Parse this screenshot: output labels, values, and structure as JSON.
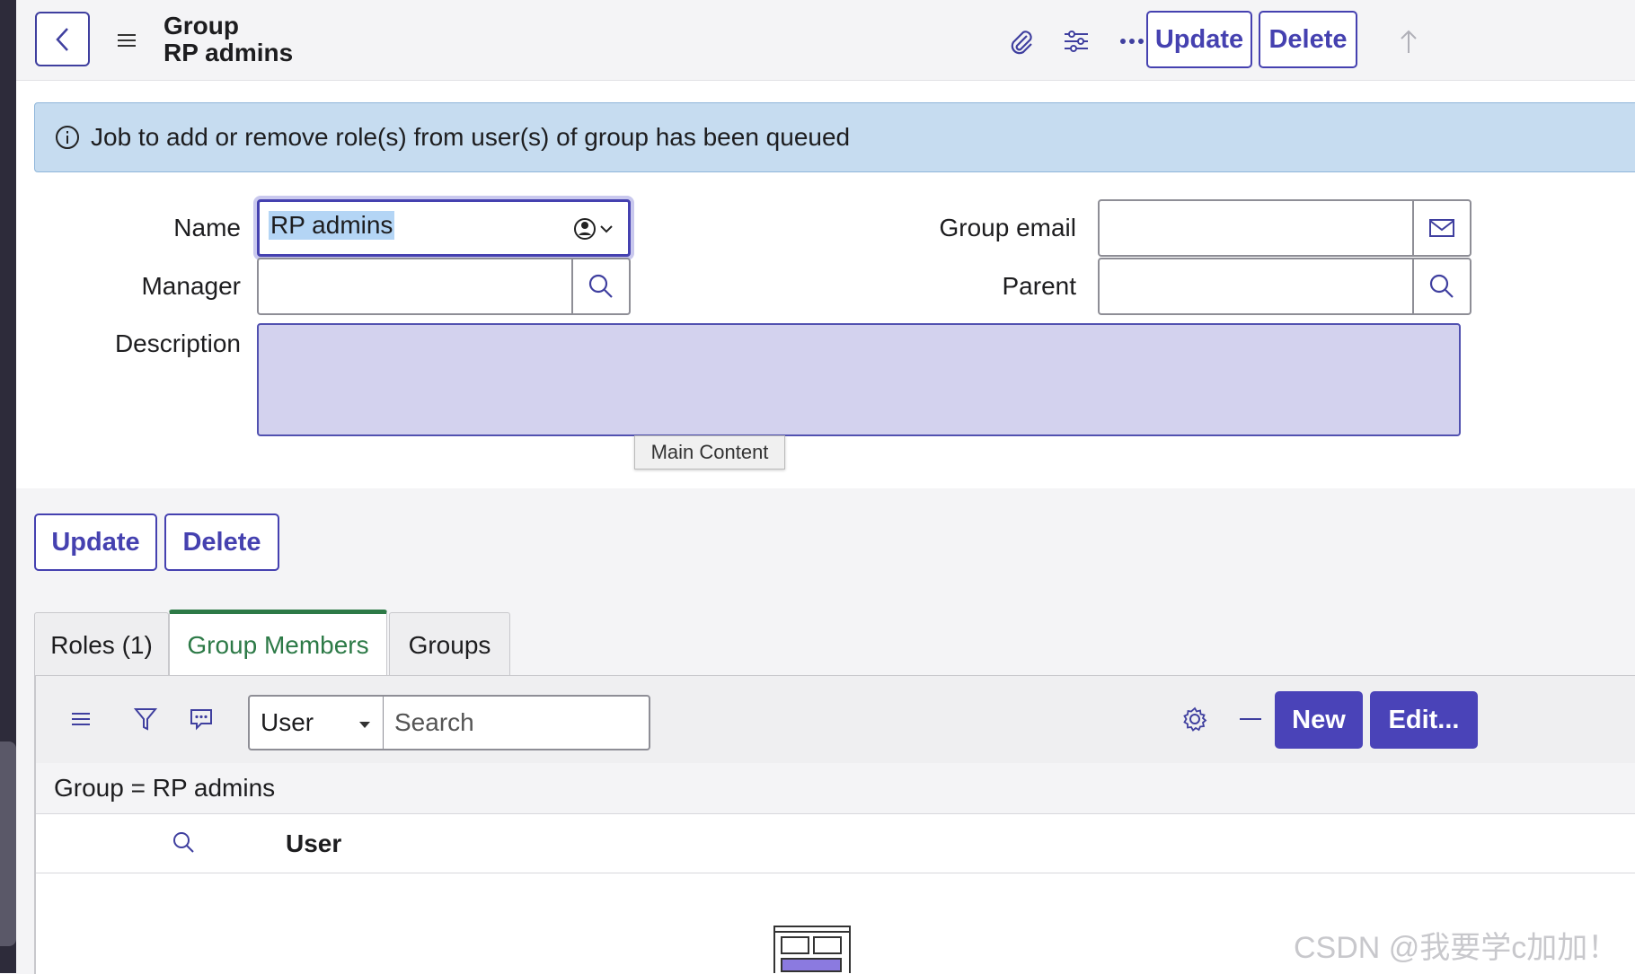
{
  "header": {
    "title_line1": "Group",
    "title_line2": "RP admins",
    "update_label": "Update",
    "delete_label": "Delete"
  },
  "banner": {
    "message": "Job to add or remove role(s) from user(s) of group has been queued",
    "close_glyph": "×"
  },
  "form": {
    "name_label": "Name",
    "name_value": "RP admins",
    "manager_label": "Manager",
    "manager_value": "",
    "description_label": "Description",
    "description_value": "",
    "group_email_label": "Group email",
    "group_email_value": "",
    "parent_label": "Parent",
    "parent_value": ""
  },
  "tooltip": "Main Content",
  "form_buttons": {
    "update_label": "Update",
    "delete_label": "Delete"
  },
  "tabs": [
    {
      "label": "Roles (1)",
      "active": false
    },
    {
      "label": "Group Members",
      "active": true
    },
    {
      "label": "Groups",
      "active": false
    }
  ],
  "related_list": {
    "select_value": "User",
    "search_placeholder": "Search",
    "new_label": "New",
    "edit_label": "Edit...",
    "breadcrumb": "Group = RP admins",
    "column_header": "User"
  },
  "watermark": "CSDN @我要学c加加！",
  "colors": {
    "accent": "#4541b0",
    "active_tab": "#2d7a47",
    "banner_bg": "#c6dcf0",
    "description_bg": "#d3d2ee"
  }
}
